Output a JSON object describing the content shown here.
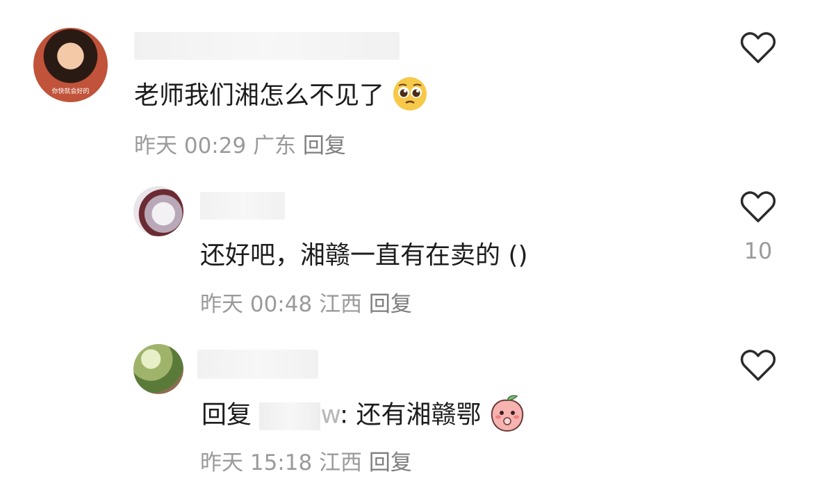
{
  "comments": [
    {
      "text": "老师我们湘怎么不见了",
      "emoji_icon": "pleading-face-emoji",
      "time": "昨天 00:29",
      "location": "广东",
      "reply_label": "回复",
      "avatar_caption": "你快就会好的"
    },
    {
      "text": "还好吧，湘赣一直有在卖的 ()",
      "time": "昨天 00:48",
      "location": "江西",
      "reply_label": "回复",
      "like_count": "10"
    },
    {
      "reply_prefix": "回复",
      "mention_tail": "w",
      "text": ": 还有湘赣鄂",
      "emoji_icon": "peach-shy-emoji",
      "time": "昨天 15:18",
      "location": "江西",
      "reply_label": "回复"
    }
  ]
}
